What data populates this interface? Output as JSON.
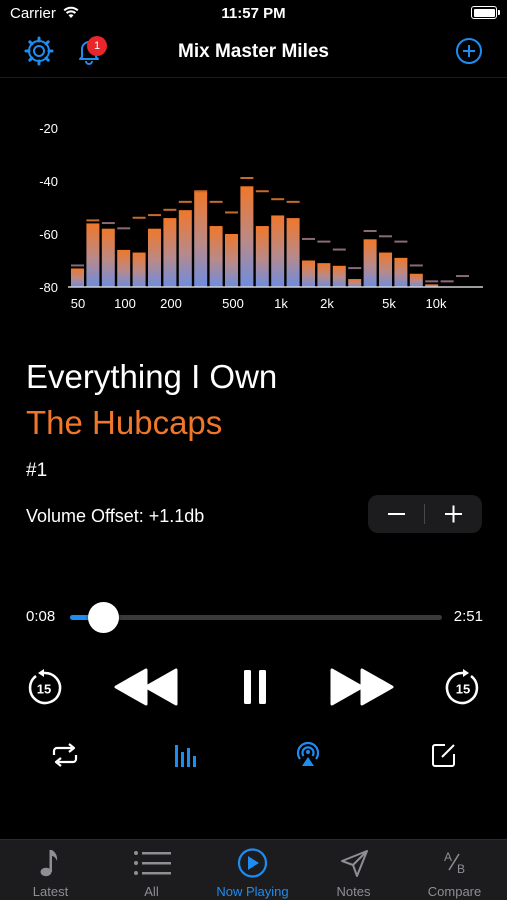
{
  "status_bar": {
    "carrier": "Carrier",
    "time": "11:57 PM"
  },
  "navbar": {
    "title": "Mix Master Miles",
    "notification_count": "1",
    "accent_color": "#1e8cf0"
  },
  "spectrum": {
    "y_ticks": [
      "-20",
      "-40",
      "-60",
      "-80"
    ],
    "x_ticks": [
      "50",
      "100",
      "200",
      "500",
      "1k",
      "2k",
      "5k",
      "10k"
    ],
    "levels_db": [
      -73,
      -56,
      -58,
      -66,
      -67,
      -58,
      -54,
      -51,
      -44,
      -57,
      -60,
      -42,
      -57,
      -53,
      -54,
      -70,
      -71,
      -72,
      -77,
      -62,
      -67,
      -69,
      -75,
      -79,
      -80,
      -80
    ],
    "peaks_db": [
      -73,
      -56,
      -57,
      -59,
      -55,
      -54,
      -52,
      -49,
      -45,
      -49,
      -53,
      -40,
      -45,
      -48,
      -49,
      -63,
      -64,
      -67,
      -74,
      -60,
      -62,
      -64,
      -73,
      -79,
      -79,
      -77
    ],
    "bar_color_top": "#f0772a",
    "bar_color_bottom": "#6e8ce0"
  },
  "track": {
    "title": "Everything I Own",
    "artist": "The Hubcaps",
    "artist_color": "#f0772a",
    "number": "#1"
  },
  "volume_offset": {
    "label": "Volume Offset: +1.1db",
    "minus": "−",
    "plus": "+"
  },
  "progress": {
    "elapsed": "0:08",
    "total": "2:51",
    "fraction": 0.09
  },
  "transport": {
    "skip_back_seconds": "15",
    "skip_forward_seconds": "15",
    "state": "playing"
  },
  "tabs": [
    {
      "label": "Latest",
      "icon": "music-note-icon",
      "active": false
    },
    {
      "label": "All",
      "icon": "list-icon",
      "active": false
    },
    {
      "label": "Now Playing",
      "icon": "play-circle-icon",
      "active": true
    },
    {
      "label": "Notes",
      "icon": "paper-plane-icon",
      "active": false
    },
    {
      "label": "Compare",
      "icon": "ab-compare-icon",
      "active": false
    }
  ]
}
